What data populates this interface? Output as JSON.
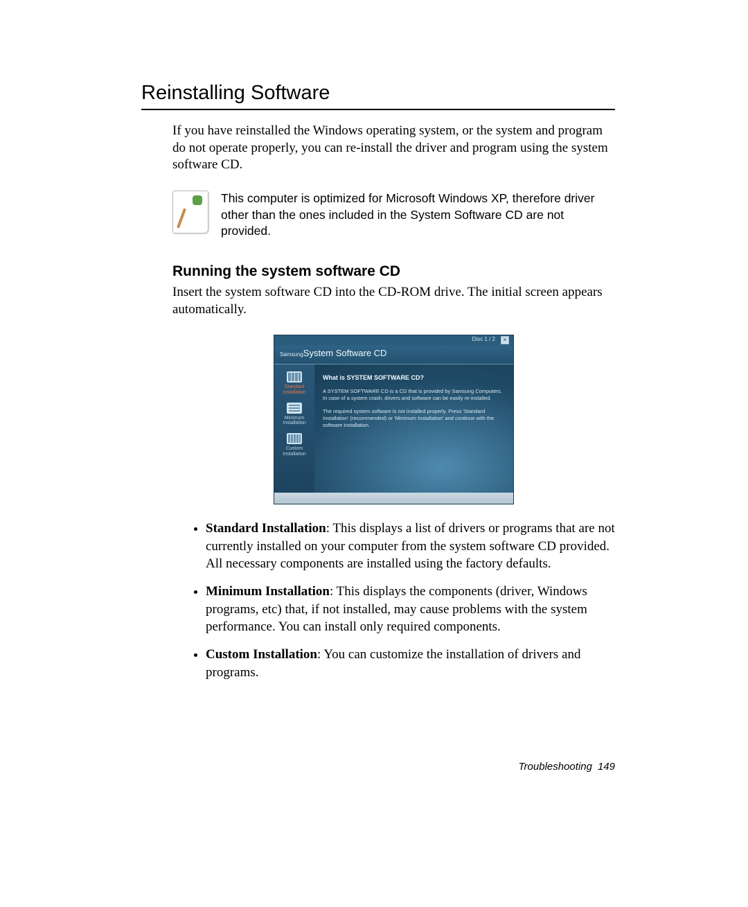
{
  "title": "Reinstalling Software",
  "intro": "If you have reinstalled the Windows operating system, or the system and program do not operate properly, you can re-install the driver and program using the system software CD.",
  "note": "This computer is optimized for Microsoft Windows XP, therefore driver other than the ones included in the System Software CD are not provided.",
  "section_heading": "Running the system software CD",
  "section_body": "Insert the system software CD into the CD-ROM drive. The initial screen appears automatically.",
  "screenshot": {
    "disc_label": "Disc 1 / 2",
    "close": "✕",
    "brand": "Samsung",
    "window_title": "System Software CD",
    "sidebar": {
      "standard": "Standard Installation",
      "minimum": "Minimum Installation",
      "custom": "Custom Installation"
    },
    "main": {
      "question": "What is SYSTEM SOFTWARE CD?",
      "p1": "A SYSTEM SOFTWARE CD is a CD that is provided by Samsung Computers. In case of a system crash, drivers and software can be easily re-installed.",
      "p2": "The required system software is not installed properly. Press 'Standard Installation' (recommended) or 'Minimum Installation' and continue with the software installation."
    }
  },
  "bullets": [
    {
      "term": "Standard Installation",
      "text": ": This displays a list of drivers or programs that are not currently installed on your computer from the system software CD provided. All necessary components are installed using the factory defaults."
    },
    {
      "term": "Minimum Installation",
      "text": ": This displays the components (driver, Windows programs, etc) that, if not installed, may cause problems with the system performance. You can install only required components."
    },
    {
      "term": "Custom Installation",
      "text": ": You can customize the installation of drivers and programs."
    }
  ],
  "footer": {
    "section": "Troubleshooting",
    "page": "149"
  }
}
